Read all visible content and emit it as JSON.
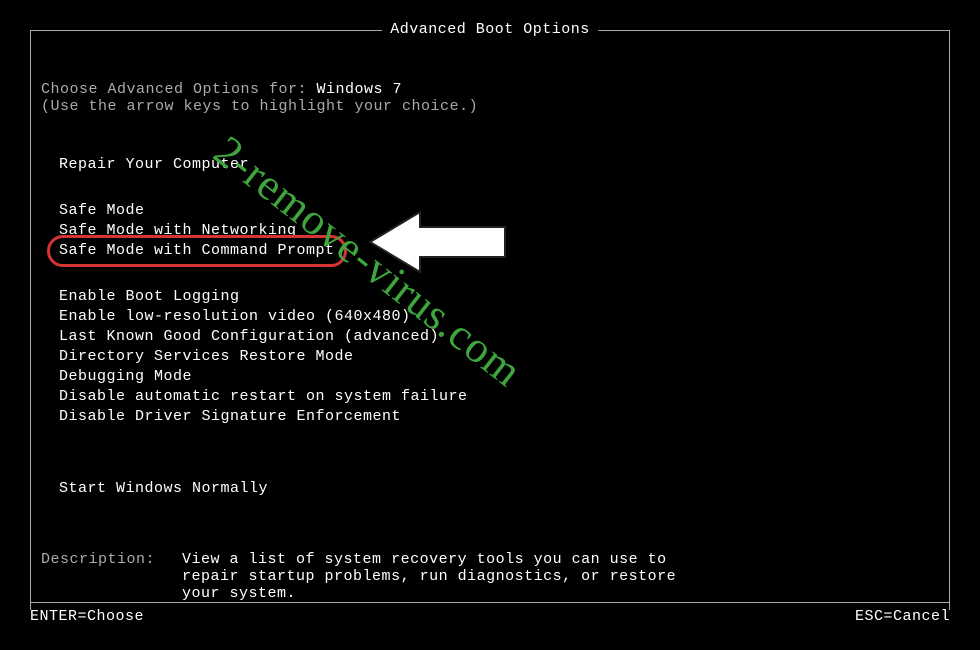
{
  "title": "Advanced Boot Options",
  "intro": {
    "line1_prefix": "Choose Advanced Options for: ",
    "os": "Windows 7",
    "line2": "(Use the arrow keys to highlight your choice.)"
  },
  "groups": {
    "repair": "Repair Your Computer",
    "safe": [
      "Safe Mode",
      "Safe Mode with Networking",
      "Safe Mode with Command Prompt"
    ],
    "other": [
      "Enable Boot Logging",
      "Enable low-resolution video (640x480)",
      "Last Known Good Configuration (advanced)",
      "Directory Services Restore Mode",
      "Debugging Mode",
      "Disable automatic restart on system failure",
      "Disable Driver Signature Enforcement"
    ],
    "normal": "Start Windows Normally"
  },
  "description": {
    "label": "Description:",
    "text": "View a list of system recovery tools you can use to repair startup problems, run diagnostics, or restore your system."
  },
  "footer": {
    "enter": "ENTER=Choose",
    "esc": "ESC=Cancel"
  },
  "watermark": "2-remove-virus.com",
  "highlight_color": "#d63333"
}
